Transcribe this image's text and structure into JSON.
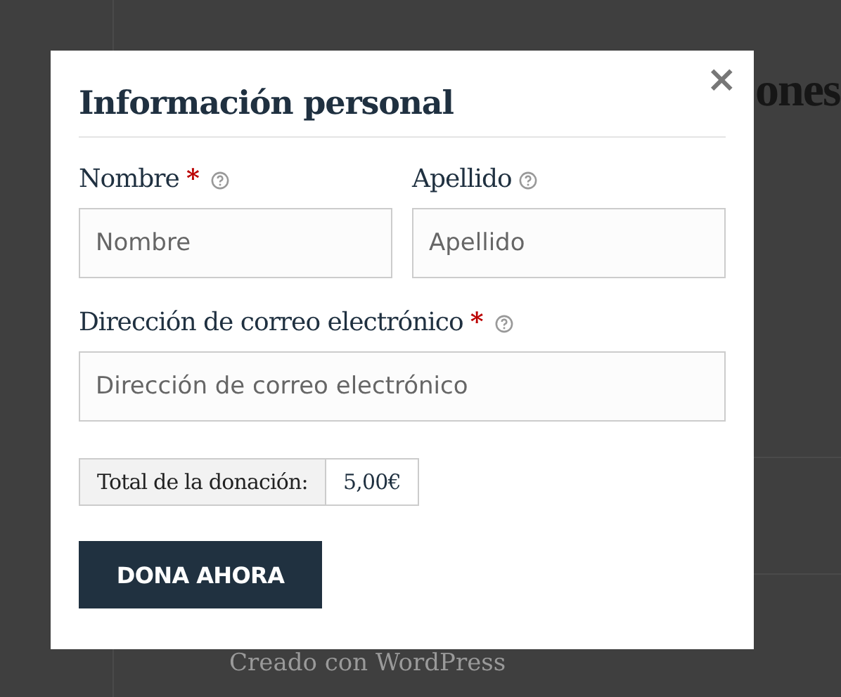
{
  "background": {
    "heading": "ones",
    "footer": "Creado con WordPress"
  },
  "dialog": {
    "title": "Información personal",
    "close": "×",
    "rows": [
      {
        "fields": [
          {
            "label": "Nombre",
            "required_mark": "*",
            "placeholder": "Nombre"
          },
          {
            "label": "Apellido",
            "placeholder": "Apellido"
          }
        ]
      },
      {
        "fields": [
          {
            "label": "Dirección de correo electrónico",
            "required_mark": "*",
            "placeholder": "Dirección de correo electrónico"
          }
        ]
      }
    ],
    "total": {
      "label": "Total de la donación:",
      "value": "5,00€"
    },
    "submit": "DONA AHORA"
  }
}
